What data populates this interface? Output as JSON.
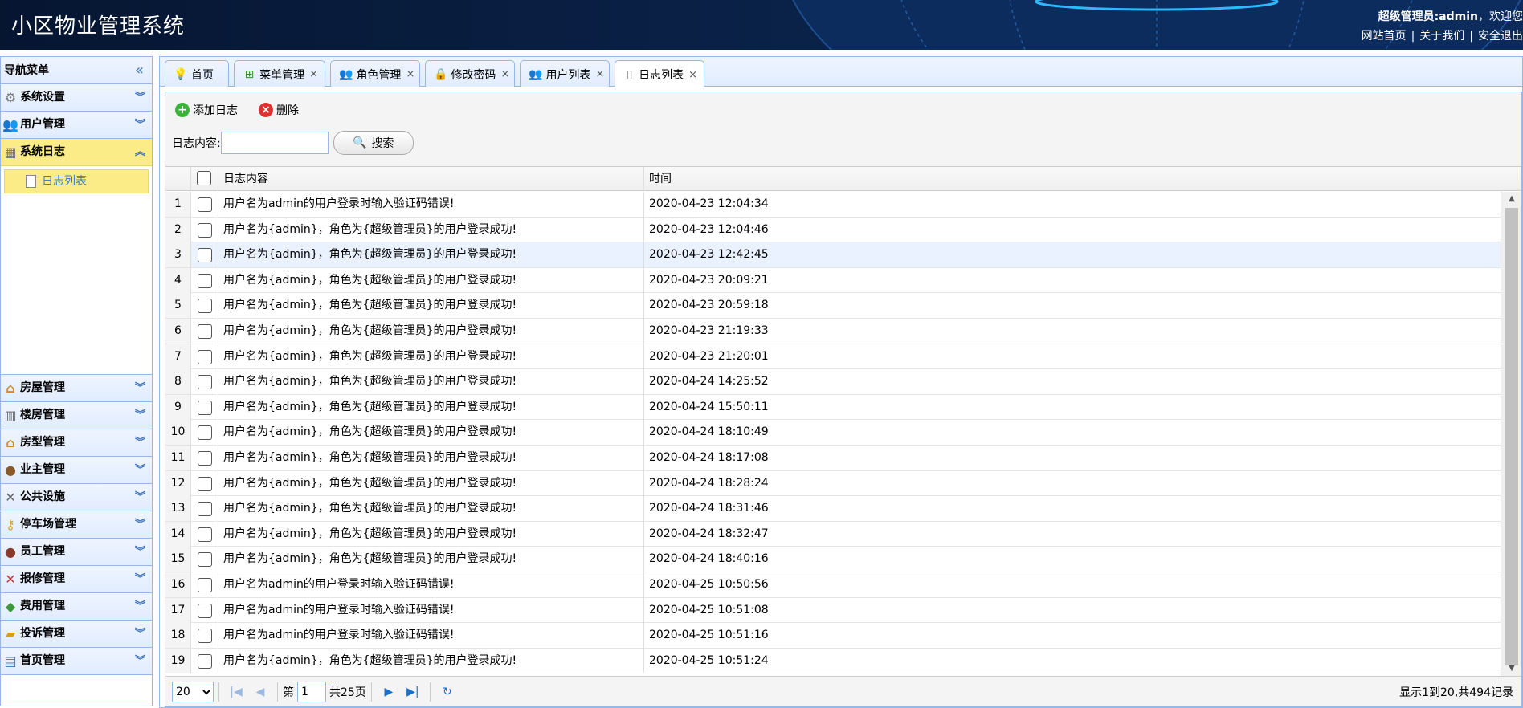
{
  "header": {
    "title": "小区物业管理系统",
    "role_user": "超级管理员:admin",
    "welcome_suffix": "，欢迎您",
    "links": [
      "网站首页",
      "关于我们",
      "安全退出"
    ]
  },
  "nav": {
    "title": "导航菜单",
    "top_items": [
      {
        "label": "系统设置",
        "icon": "gear-icon"
      },
      {
        "label": "用户管理",
        "icon": "users-icon"
      },
      {
        "label": "系统日志",
        "icon": "log-icon"
      }
    ],
    "sub_items": [
      {
        "label": "日志列表",
        "icon": "page-icon"
      }
    ],
    "bottom_items": [
      {
        "label": "房屋管理",
        "icon": "house-icon"
      },
      {
        "label": "楼房管理",
        "icon": "building-icon"
      },
      {
        "label": "房型管理",
        "icon": "house-icon"
      },
      {
        "label": "业主管理",
        "icon": "person-icon"
      },
      {
        "label": "公共设施",
        "icon": "tools-icon"
      },
      {
        "label": "停车场管理",
        "icon": "key-icon"
      },
      {
        "label": "员工管理",
        "icon": "person-icon"
      },
      {
        "label": "报修管理",
        "icon": "wrench-icon"
      },
      {
        "label": "费用管理",
        "icon": "money-icon"
      },
      {
        "label": "投诉管理",
        "icon": "folder-icon"
      },
      {
        "label": "首页管理",
        "icon": "window-icon"
      }
    ]
  },
  "tabs": [
    {
      "label": "首页",
      "icon": "bulb-icon",
      "closable": false
    },
    {
      "label": "菜单管理",
      "icon": "tree-icon",
      "closable": true
    },
    {
      "label": "角色管理",
      "icon": "users-icon",
      "closable": true
    },
    {
      "label": "修改密码",
      "icon": "lock-icon",
      "closable": true
    },
    {
      "label": "用户列表",
      "icon": "users-icon",
      "closable": true
    },
    {
      "label": "日志列表",
      "icon": "page-icon",
      "closable": true
    }
  ],
  "toolbar": {
    "add_label": "添加日志",
    "delete_label": "删除",
    "search_label": "日志内容:",
    "search_value": "",
    "search_button": "搜索"
  },
  "grid": {
    "columns": [
      "日志内容",
      "时间"
    ],
    "rows": [
      {
        "n": "1",
        "content": "用户名为admin的用户登录时输入验证码错误!",
        "time": "2020-04-23 12:04:34"
      },
      {
        "n": "2",
        "content": "用户名为{admin}，角色为{超级管理员}的用户登录成功!",
        "time": "2020-04-23 12:04:46"
      },
      {
        "n": "3",
        "content": "用户名为{admin}，角色为{超级管理员}的用户登录成功!",
        "time": "2020-04-23 12:42:45"
      },
      {
        "n": "4",
        "content": "用户名为{admin}，角色为{超级管理员}的用户登录成功!",
        "time": "2020-04-23 20:09:21"
      },
      {
        "n": "5",
        "content": "用户名为{admin}，角色为{超级管理员}的用户登录成功!",
        "time": "2020-04-23 20:59:18"
      },
      {
        "n": "6",
        "content": "用户名为{admin}，角色为{超级管理员}的用户登录成功!",
        "time": "2020-04-23 21:19:33"
      },
      {
        "n": "7",
        "content": "用户名为{admin}，角色为{超级管理员}的用户登录成功!",
        "time": "2020-04-23 21:20:01"
      },
      {
        "n": "8",
        "content": "用户名为{admin}，角色为{超级管理员}的用户登录成功!",
        "time": "2020-04-24 14:25:52"
      },
      {
        "n": "9",
        "content": "用户名为{admin}，角色为{超级管理员}的用户登录成功!",
        "time": "2020-04-24 15:50:11"
      },
      {
        "n": "10",
        "content": "用户名为{admin}，角色为{超级管理员}的用户登录成功!",
        "time": "2020-04-24 18:10:49"
      },
      {
        "n": "11",
        "content": "用户名为{admin}，角色为{超级管理员}的用户登录成功!",
        "time": "2020-04-24 18:17:08"
      },
      {
        "n": "12",
        "content": "用户名为{admin}，角色为{超级管理员}的用户登录成功!",
        "time": "2020-04-24 18:28:24"
      },
      {
        "n": "13",
        "content": "用户名为{admin}，角色为{超级管理员}的用户登录成功!",
        "time": "2020-04-24 18:31:46"
      },
      {
        "n": "14",
        "content": "用户名为{admin}，角色为{超级管理员}的用户登录成功!",
        "time": "2020-04-24 18:32:47"
      },
      {
        "n": "15",
        "content": "用户名为{admin}，角色为{超级管理员}的用户登录成功!",
        "time": "2020-04-24 18:40:16"
      },
      {
        "n": "16",
        "content": "用户名为admin的用户登录时输入验证码错误!",
        "time": "2020-04-25 10:50:56"
      },
      {
        "n": "17",
        "content": "用户名为admin的用户登录时输入验证码错误!",
        "time": "2020-04-25 10:51:08"
      },
      {
        "n": "18",
        "content": "用户名为admin的用户登录时输入验证码错误!",
        "time": "2020-04-25 10:51:16"
      },
      {
        "n": "19",
        "content": "用户名为{admin}，角色为{超级管理员}的用户登录成功!",
        "time": "2020-04-25 10:51:24"
      }
    ],
    "highlighted_row": 3
  },
  "pager": {
    "page_size": "20",
    "page_prefix": "第",
    "page_value": "1",
    "page_suffix": "共25页",
    "info": "显示1到20,共494记录"
  },
  "colors": {
    "header_bg": "#0a2147",
    "panel_border": "#95b8e7",
    "active_nav": "#fbec88",
    "link_blue": "#3d7dc4"
  }
}
